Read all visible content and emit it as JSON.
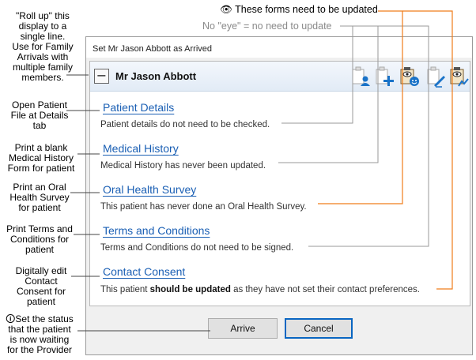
{
  "annotations": {
    "top_updated": "These forms need to be updated",
    "top_no_eye": "No \"eye\" = no need to update",
    "roll_up": [
      "\"Roll up\" this",
      "display to a",
      "single line.",
      "Use for Family",
      "Arrivals with",
      "multiple family",
      "members."
    ],
    "open_patient": [
      "Open Patient",
      "File at Details",
      "tab"
    ],
    "print_blank": [
      "Print a blank",
      "Medical History",
      "Form for patient"
    ],
    "print_oral": [
      "Print an Oral",
      "Health Survey",
      "for patient"
    ],
    "print_terms": [
      "Print Terms and",
      "Conditions for",
      "patient"
    ],
    "digitally_edit": [
      "Digitally edit",
      "Contact",
      "Consent for",
      "patient"
    ],
    "set_status": [
      "Set the status",
      "that the patient",
      "is now waiting",
      "for the Provider"
    ]
  },
  "dialog": {
    "title": "Set Mr Jason Abbott as Arrived",
    "collapse_symbol": "−",
    "patient_name": "Mr Jason Abbott",
    "forms": [
      {
        "label": "Patient Details",
        "status": "Patient details do not need to be checked."
      },
      {
        "label": "Medical History",
        "status": "Medical History has never been updated."
      },
      {
        "label": "Oral Health Survey",
        "status": "This patient has never done an Oral Health Survey."
      },
      {
        "label": "Terms and Conditions",
        "status": "Terms and Conditions do not need to be signed."
      },
      {
        "label": "Contact Consent",
        "status_prefix": "This patient ",
        "status_bold": "should be updated",
        "status_suffix": " as they have not set their contact preferences."
      }
    ],
    "icons": [
      "patient-details-icon",
      "medical-history-add-icon",
      "oral-health-survey-eye-icon",
      "terms-sign-icon",
      "contact-consent-eye-icon"
    ],
    "buttons": {
      "arrive": "Arrive",
      "cancel": "Cancel"
    }
  },
  "colors": {
    "accent": "#1a5fb4",
    "update_line": "#f07d1a",
    "gray_line": "#9a9a9a"
  }
}
